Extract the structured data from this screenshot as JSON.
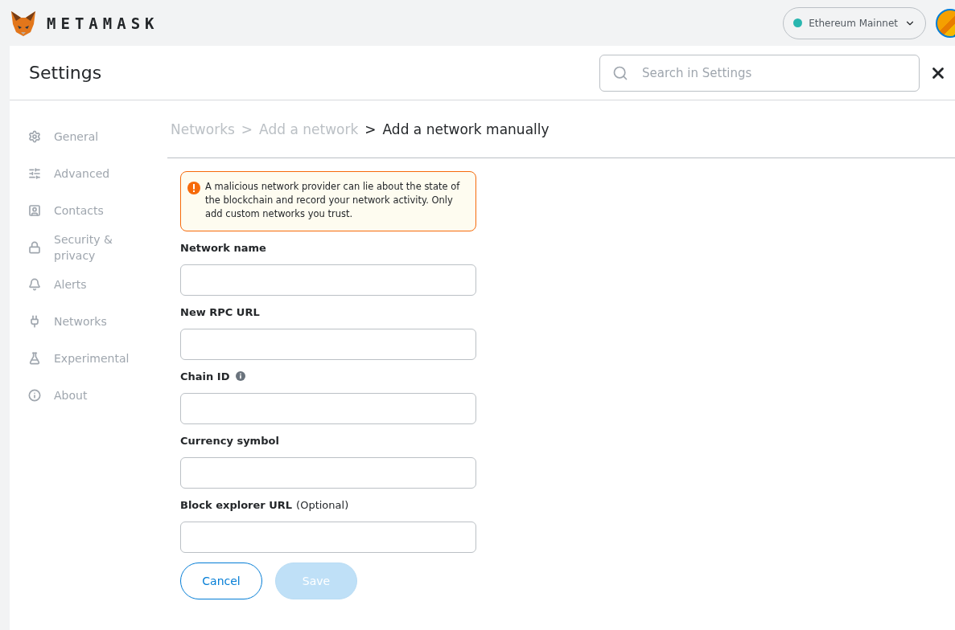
{
  "app": {
    "logo_text": "METAMASK",
    "network": {
      "name": "Ethereum Mainnet",
      "color": "#29b6af"
    }
  },
  "settings": {
    "title": "Settings",
    "search": {
      "placeholder": "Search in Settings"
    }
  },
  "sidebar": {
    "items": [
      {
        "kind": "gear",
        "label": "General",
        "selected": false
      },
      {
        "kind": "sliders",
        "label": "Advanced",
        "selected": false
      },
      {
        "kind": "contact",
        "label": "Contacts",
        "selected": false
      },
      {
        "kind": "lock",
        "label": "Security & privacy",
        "selected": false
      },
      {
        "kind": "bell",
        "label": "Alerts",
        "selected": false
      },
      {
        "kind": "plug",
        "label": "Networks",
        "selected": false
      },
      {
        "kind": "flask",
        "label": "Experimental",
        "selected": false
      },
      {
        "kind": "info",
        "label": "About",
        "selected": false
      }
    ]
  },
  "breadcrumb": [
    {
      "label": "Networks",
      "selected": false
    },
    {
      "separator": ">",
      "label": "Add a network",
      "selected": false
    },
    {
      "separator": ">",
      "label": "Add a network manually",
      "selected": true
    }
  ],
  "warning": "A malicious network provider can lie about the state of the blockchain and record your network activity. Only add custom networks you trust.",
  "fields": [
    {
      "kind": "plain",
      "label": "Network name"
    },
    {
      "kind": "plain",
      "label": "New RPC URL"
    },
    {
      "kind": "info",
      "label": "Chain ID"
    },
    {
      "kind": "plain",
      "label": "Currency symbol"
    },
    {
      "kind": "plain",
      "label": "Block explorer URL",
      "note": "(Optional)"
    }
  ],
  "buttons": [
    {
      "kind": "secondary",
      "label": "Cancel",
      "disabled": false
    },
    {
      "kind": "primary",
      "label": "Save",
      "disabled": true
    }
  ]
}
